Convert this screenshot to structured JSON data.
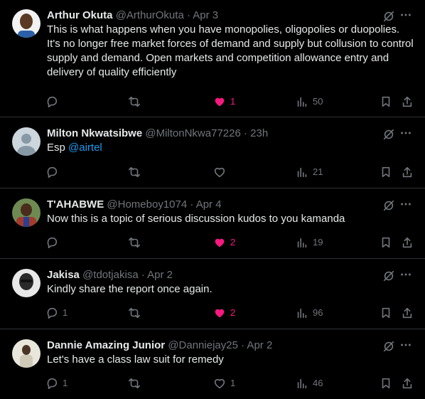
{
  "colors": {
    "background": "#000000",
    "text": "#e7e9ea",
    "muted": "#71767b",
    "link": "#1d9bf0",
    "like": "#f91880",
    "divider": "#2f3336"
  },
  "tweets": [
    {
      "name": "Arthur Okuta",
      "handle_time": "@ArthurOkuta · Apr 3",
      "text": "This is what happens when you have monopolies, oligopolies or duopolies. It's no longer free market forces of demand and supply but collusion to control supply and demand. Open markets and competition allowance entry and delivery of quality efficiently",
      "replies": "",
      "retweets": "",
      "likes": "1",
      "liked": true,
      "views": "50",
      "avatar_color": "#6b4a2e"
    },
    {
      "name": "Milton Nkwatsibwe",
      "handle_time": "@MiltonNkwa77226 · 23h",
      "text_prefix": "Esp ",
      "mention": "@airtel",
      "replies": "",
      "retweets": "",
      "likes": "",
      "liked": false,
      "views": "21",
      "avatar_color": "#8899a6"
    },
    {
      "name": "T'AHABWE",
      "handle_time": "@Homeboy1074 · Apr 4",
      "text": "Now this is a topic of serious discussion kudos to you kamanda",
      "replies": "",
      "retweets": "",
      "likes": "2",
      "liked": true,
      "views": "19",
      "avatar_color": "#a33b2c"
    },
    {
      "name": "Jakisa",
      "handle_time": "@tdotjakisa · Apr 2",
      "text": "Kindly share the report once again.",
      "replies": "1",
      "retweets": "",
      "likes": "2",
      "liked": true,
      "views": "96",
      "avatar_color": "#3a3a3a"
    },
    {
      "name": "Dannie Amazing Junior",
      "handle_time": "@Danniejay25 · Apr 2",
      "text": "Let's have a class law suit for remedy",
      "replies": "1",
      "retweets": "",
      "likes": "1",
      "liked": false,
      "views": "46",
      "avatar_color": "#d8d2c4"
    }
  ]
}
